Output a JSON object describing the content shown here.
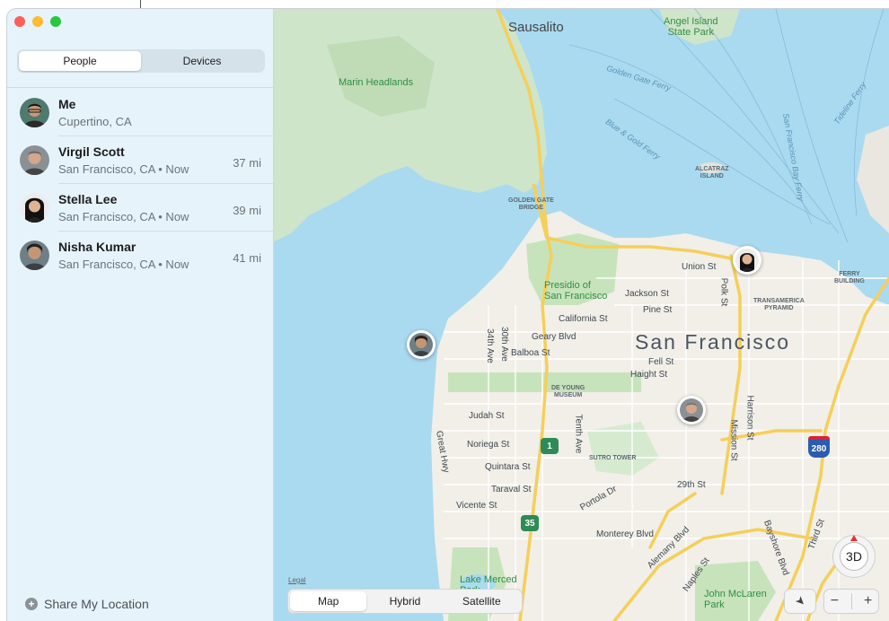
{
  "sidebar": {
    "tabs": [
      {
        "label": "People",
        "active": true
      },
      {
        "label": "Devices",
        "active": false
      }
    ],
    "people": [
      {
        "name": "Me",
        "location": "Cupertino, CA",
        "distance": ""
      },
      {
        "name": "Virgil Scott",
        "location": "San Francisco, CA • Now",
        "distance": "37 mi"
      },
      {
        "name": "Stella Lee",
        "location": "San Francisco, CA • Now",
        "distance": "39 mi"
      },
      {
        "name": "Nisha Kumar",
        "location": "San Francisco, CA • Now",
        "distance": "41 mi"
      }
    ],
    "share_label": "Share My Location"
  },
  "map": {
    "city": "San Francisco",
    "places": {
      "sausalito": "Sausalito",
      "angel_island": "Angel Island\nState Park",
      "marin": "Marin Headlands",
      "golden_gate_bridge": "GOLDEN GATE\nBRIDGE",
      "alcatraz": "ALCATRAZ\nISLAND",
      "transamerica": "TRANSAMERICA\nPYRAMID",
      "ferry_building": "FERRY\nBUILDING",
      "presidio": "Presidio of\nSan Francisco",
      "de_young": "DE YOUNG\nMUSEUM",
      "sutro": "SUTRO TOWER",
      "lake_merced": "Lake Merced\nPark",
      "mclaren": "John McLaren\nPark"
    },
    "ferries": {
      "golden_gate": "Golden Gate Ferry",
      "blue_gold": "Blue & Gold Ferry",
      "sf_bay": "San Francisco Bay Ferry",
      "tideline": "Tideline Ferry"
    },
    "streets": {
      "union": "Union St",
      "polk": "Polk St",
      "jackson": "Jackson St",
      "pine": "Pine St",
      "california": "California St",
      "geary": "Geary Blvd",
      "balboa": "Balboa St",
      "fell": "Fell St",
      "haight": "Haight St",
      "judah": "Judah St",
      "noriega": "Noriega St",
      "quintara": "Quintara St",
      "taraval": "Taraval St",
      "vicente": "Vicente St",
      "thirtieth": "30th Ave",
      "thirtyfourth": "34th Ave",
      "tenth": "Tenth Ave",
      "great_hwy": "Great Hwy",
      "portola": "Portola Dr",
      "mission": "Mission St",
      "harrison": "Harrison St",
      "twentyninth": "29th St",
      "monterey": "Monterey Blvd",
      "alemany": "Alemany Blvd",
      "naples": "Naples St",
      "bayshore": "Bayshore Blvd",
      "third": "Third St"
    },
    "shields": {
      "hwy1": "1",
      "hwy35": "35",
      "i280": "280"
    },
    "legal": "Legal",
    "map_types": [
      {
        "label": "Map",
        "active": true
      },
      {
        "label": "Hybrid",
        "active": false
      },
      {
        "label": "Satellite",
        "active": false
      }
    ],
    "compass_label": "3D",
    "zoom_out": "−",
    "zoom_in": "+",
    "location_icon": "location-arrow-icon"
  }
}
